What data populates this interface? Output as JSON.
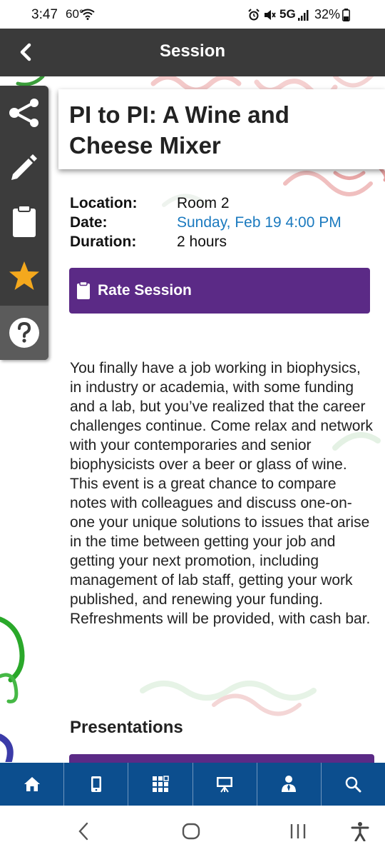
{
  "status_bar": {
    "time": "3:47",
    "temperature": "60°",
    "network": "5G",
    "battery": "32%"
  },
  "header": {
    "title": "Session"
  },
  "tools": [
    "share-icon",
    "pencil-icon",
    "clipboard-icon",
    "star-icon",
    "help-icon"
  ],
  "session": {
    "title": "PI to PI: A Wine and Cheese Mixer",
    "location_label": "Location:",
    "location": "Room 2",
    "date_label": "Date:",
    "date": "Sunday, Feb 19 4:00 PM",
    "duration_label": "Duration:",
    "duration": "2 hours",
    "rate_button": "Rate Session",
    "description": "You finally have a job working in biophysics, in industry or academia, with some funding and a lab, but you’ve realized that the career challenges continue. Come relax and network with your contemporaries and senior biophysicists over a beer or glass of wine. This event is a great chance to compare notes with colleagues and discuss one-on-one your unique solutions to issues that arise in the time between getting your job and getting your next promotion, including management of lab staff, getting your work published, and renewing your funding. Refreshments will be provided, with cash bar.",
    "presentations_heading": "Presentations"
  },
  "tab_bar": [
    "home-icon",
    "mobile-device-icon",
    "grid-icon",
    "presentation-icon",
    "speaker-icon",
    "search-icon"
  ],
  "colors": {
    "header": "#3a3a3a",
    "accent_purple": "#5b2a86",
    "link_blue": "#1b7abf",
    "tab_bar": "#0c4e8e",
    "star": "#f4a81d"
  }
}
